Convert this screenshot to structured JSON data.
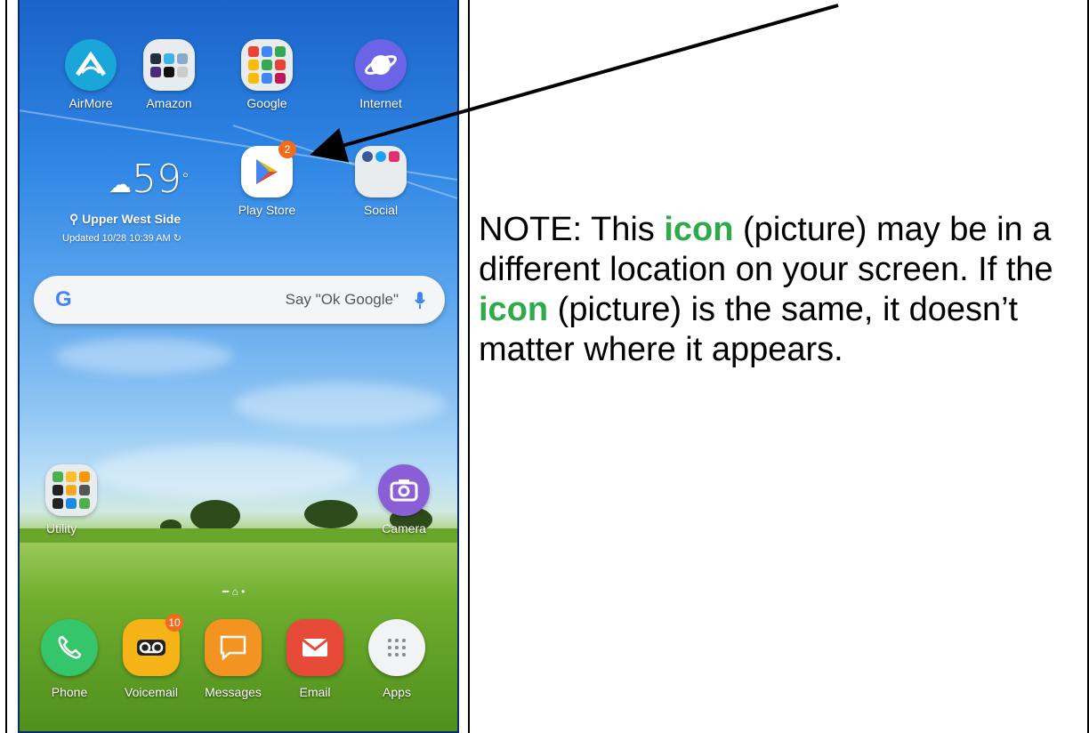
{
  "home_screen": {
    "apps_row1": [
      {
        "label": "AirMore",
        "icon": "airmore-icon"
      },
      {
        "label": "Amazon",
        "icon": "amazon-folder-icon"
      },
      {
        "label": "Google",
        "icon": "google-folder-icon"
      },
      {
        "label": "Internet",
        "icon": "internet-icon"
      }
    ],
    "apps_row2": [
      {
        "label": "Play Store",
        "icon": "play-store-icon",
        "badge": "2"
      },
      {
        "label": "Social",
        "icon": "social-folder-icon"
      }
    ],
    "weather": {
      "temp": "59",
      "location": "Upper West Side",
      "updated": "Updated 10/28 10:39 AM"
    },
    "search": {
      "logo": "G",
      "placeholder": "Say \"Ok Google\""
    },
    "lower_apps": [
      {
        "label": "Utility",
        "icon": "utility-folder-icon"
      },
      {
        "label": "Camera",
        "icon": "camera-icon"
      }
    ],
    "dock": [
      {
        "label": "Phone",
        "icon": "phone-icon",
        "color": "#35c56a"
      },
      {
        "label": "Voicemail",
        "icon": "voicemail-icon",
        "color": "#f5b318",
        "badge": "10"
      },
      {
        "label": "Messages",
        "icon": "messages-icon",
        "color": "#f39322"
      },
      {
        "label": "Email",
        "icon": "email-icon",
        "color": "#e84a3a"
      },
      {
        "label": "Apps",
        "icon": "apps-grid-icon",
        "color": "#f1f3f4"
      }
    ]
  },
  "note": {
    "prefix": "NOTE: This ",
    "word1": "icon",
    "mid1": " (picture) may be in a different location on your screen. If the ",
    "word2": "icon",
    "suffix": " (picture) is the same, it doesn’t matter where it appears."
  },
  "colors": {
    "highlight": "#2eaa4a",
    "badge": "#f26b1d"
  }
}
